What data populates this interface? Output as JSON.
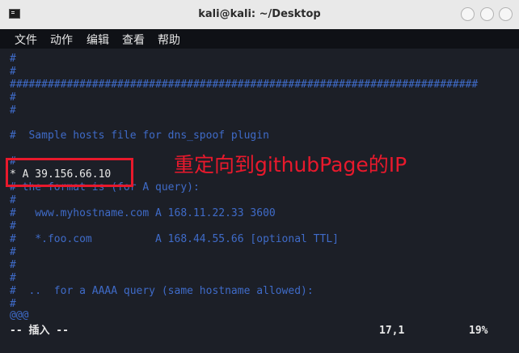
{
  "window": {
    "title": "kali@kali: ~/Desktop",
    "icon": "terminal-icon",
    "buttons": [
      "minimize",
      "maximize",
      "close"
    ]
  },
  "menu": [
    "文件",
    "动作",
    "编辑",
    "查看",
    "帮助"
  ],
  "editor": {
    "lines": [
      "#",
      "#",
      "##########################################################################",
      "#",
      "#",
      "#  Sample hosts file for dns_spoof plugin",
      "#",
      "* A 39.156.66.10",
      "# the format is (for A query):",
      "#",
      "#   www.myhostname.com A 168.11.22.33 3600",
      "#",
      "#   *.foo.com          A 168.44.55.66 [optional TTL]",
      "#",
      "#",
      "#",
      "#  ..  for a AAAA query (same hostname allowed):",
      "#",
      "@@@"
    ],
    "status_mode": "-- 插入 --",
    "status_position": "17,1",
    "status_percent": "19%"
  },
  "annotation": {
    "text": "重定向到githubPage的IP",
    "color": "#e8192c"
  }
}
